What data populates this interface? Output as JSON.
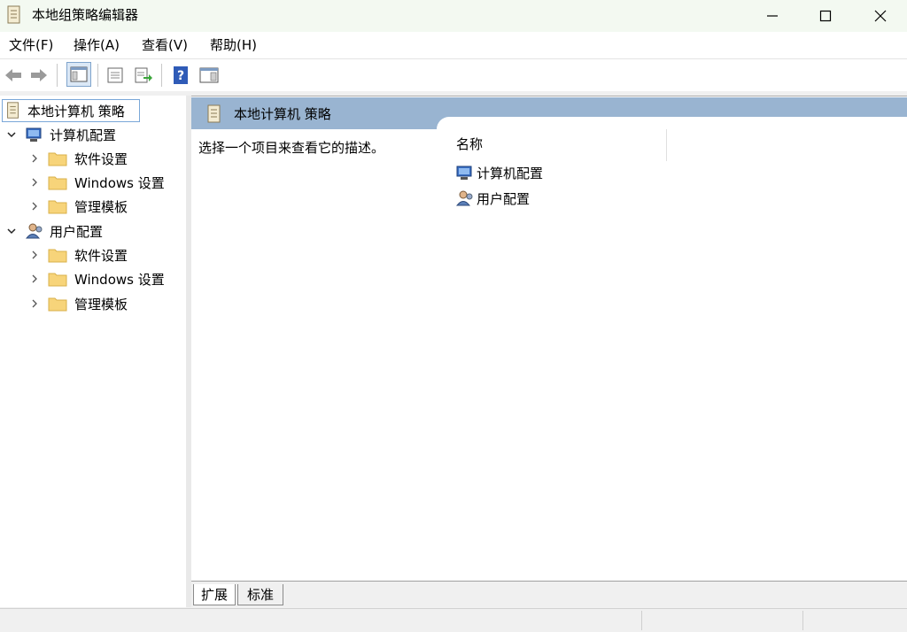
{
  "window": {
    "title": "本地组策略编辑器"
  },
  "menu": [
    "文件(F)",
    "操作(A)",
    "查看(V)",
    "帮助(H)"
  ],
  "toolbar": {
    "icons": [
      "back-arrow-icon",
      "forward-arrow-icon",
      "show-hide-tree-icon",
      "properties-icon",
      "export-list-icon",
      "help-icon",
      "show-hide-action-pane-icon"
    ]
  },
  "tree": {
    "root": "本地计算机 策略",
    "computer": {
      "label": "计算机配置",
      "children": [
        "软件设置",
        "Windows 设置",
        "管理模板"
      ]
    },
    "user": {
      "label": "用户配置",
      "children": [
        "软件设置",
        "Windows 设置",
        "管理模板"
      ]
    }
  },
  "right": {
    "header_title": "本地计算机 策略",
    "description": "选择一个项目来查看它的描述。",
    "column_name": "名称",
    "items": [
      "计算机配置",
      "用户配置"
    ]
  },
  "tabs": [
    "扩展",
    "标准"
  ],
  "colors": {
    "header_band": "#99b4d1",
    "folder": "#f7d47a",
    "help_icon": "#2f5bb7",
    "selection_border": "#7aa7d8"
  }
}
